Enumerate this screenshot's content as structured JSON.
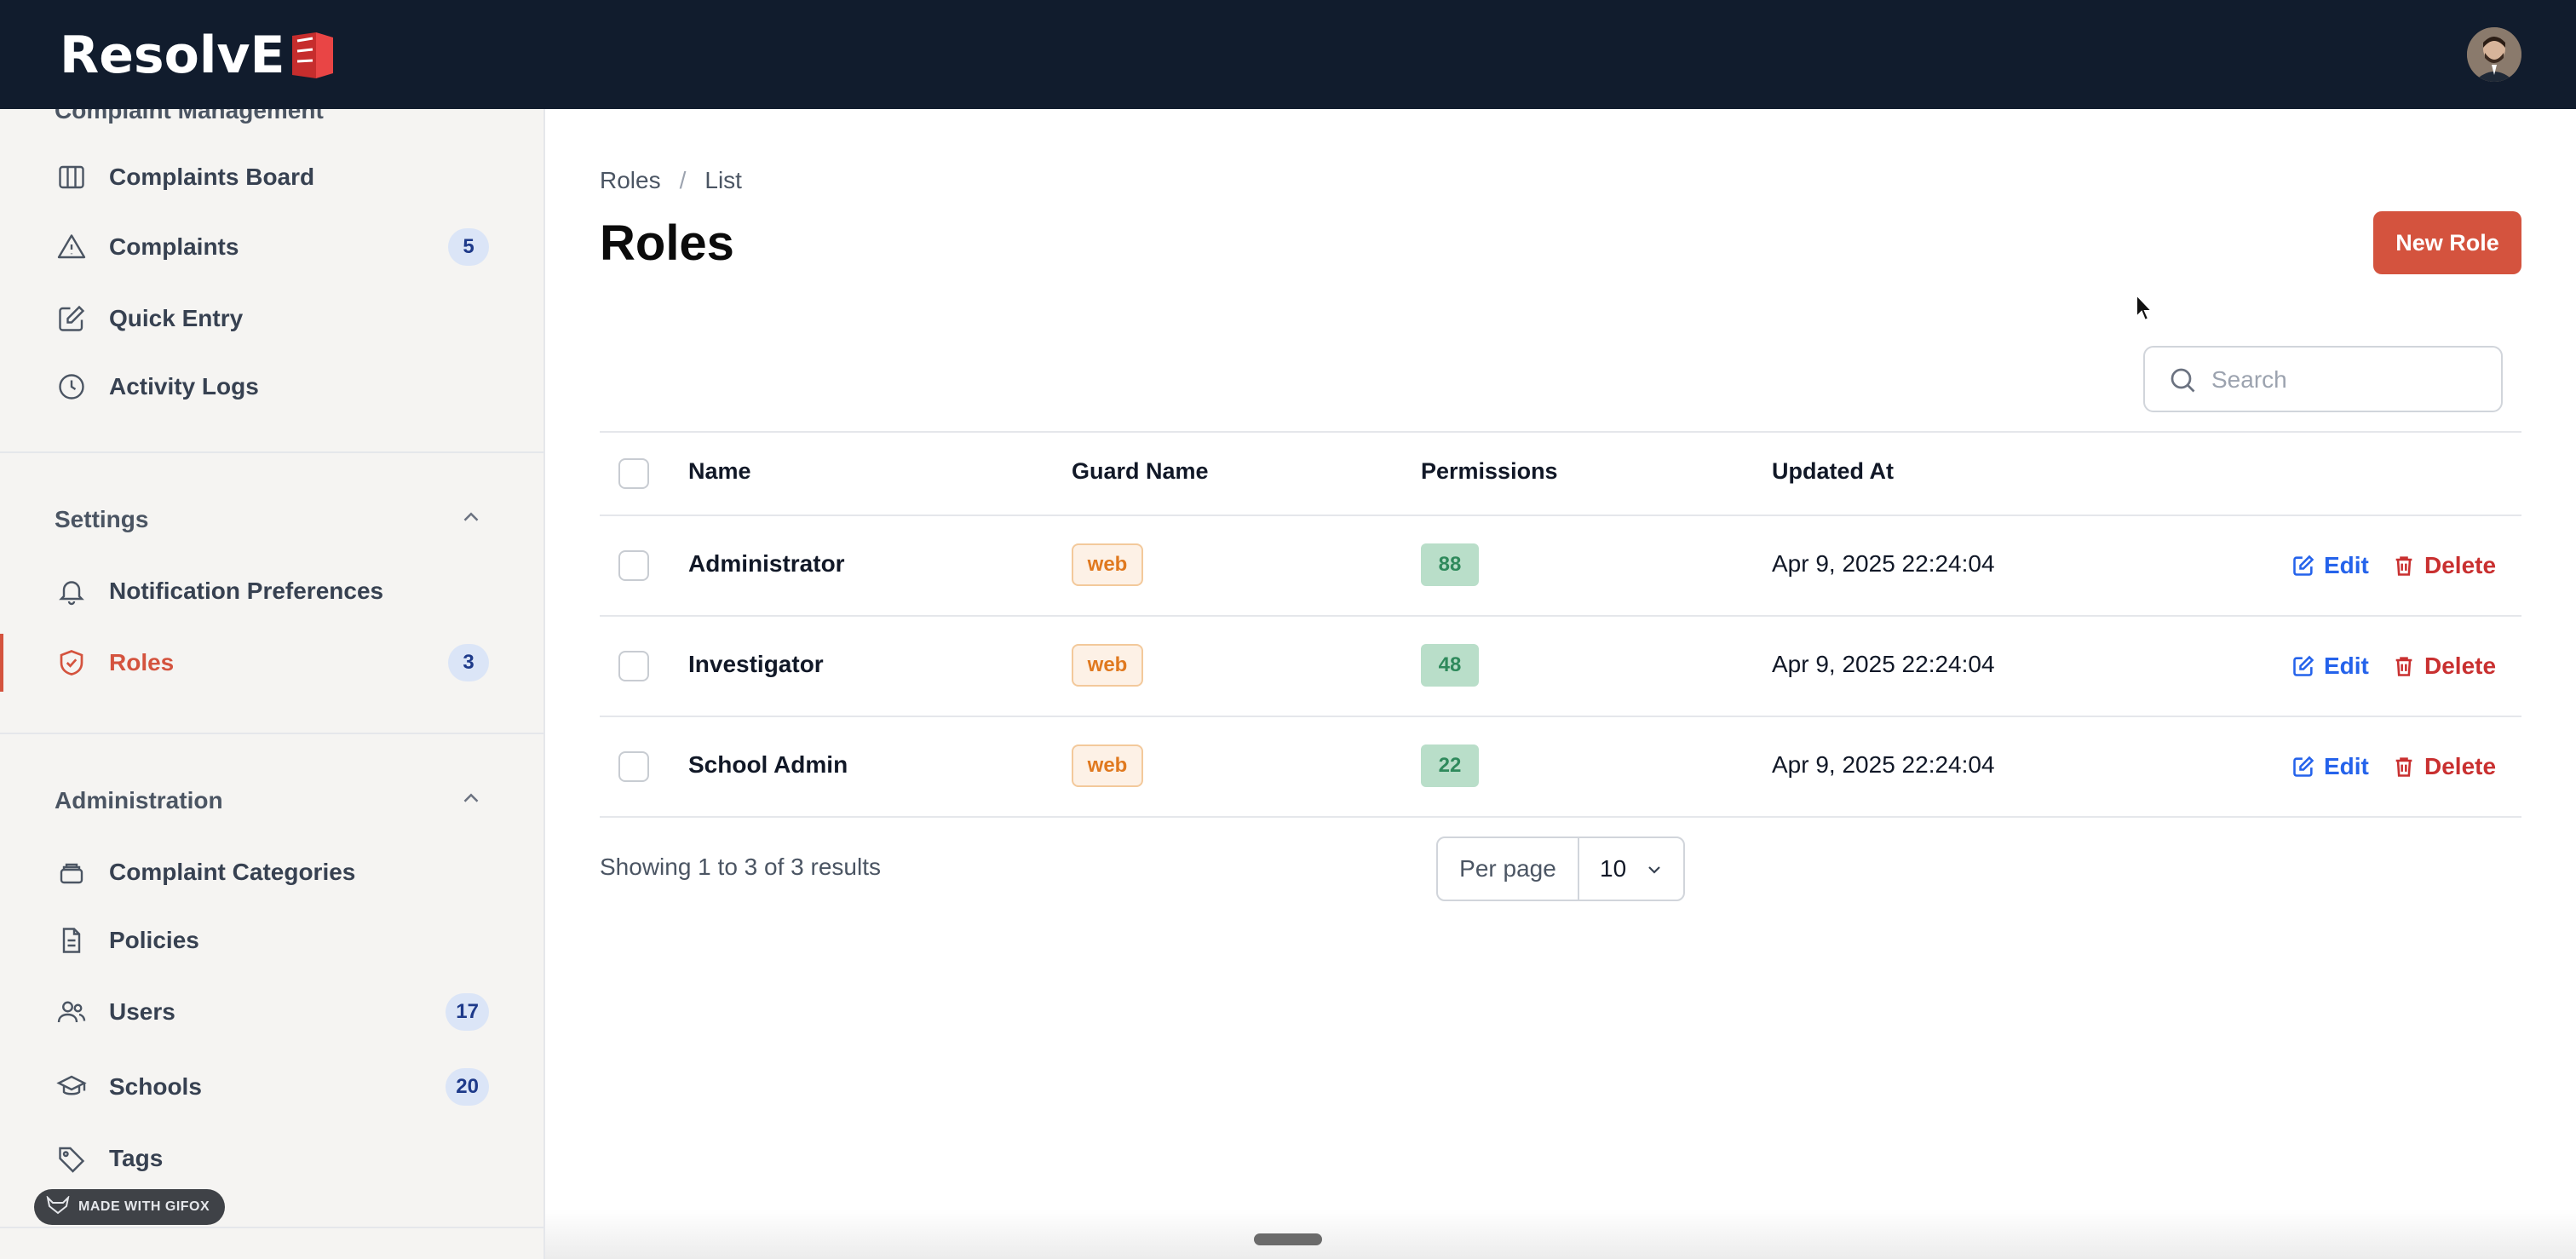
{
  "app": {
    "logo_text": "ResolvE",
    "logo_tail": "D"
  },
  "sidebar": {
    "clipped_section": "Complaint Management",
    "complaint_items": [
      {
        "label": "Complaints Board",
        "icon": "board-columns-icon"
      },
      {
        "label": "Complaints",
        "icon": "warning-triangle-icon",
        "badge": "5"
      },
      {
        "label": "Quick Entry",
        "icon": "pencil-square-icon"
      },
      {
        "label": "Activity Logs",
        "icon": "clock-icon"
      }
    ],
    "settings": {
      "title": "Settings",
      "items": [
        {
          "label": "Notification Preferences",
          "icon": "bell-icon"
        },
        {
          "label": "Roles",
          "icon": "shield-check-icon",
          "badge": "3",
          "active": true
        }
      ]
    },
    "administration": {
      "title": "Administration",
      "items": [
        {
          "label": "Complaint Categories",
          "icon": "layers-icon"
        },
        {
          "label": "Policies",
          "icon": "document-icon"
        },
        {
          "label": "Users",
          "icon": "users-icon",
          "badge": "17"
        },
        {
          "label": "Schools",
          "icon": "graduation-cap-icon",
          "badge": "20"
        },
        {
          "label": "Tags",
          "icon": "tag-icon"
        }
      ]
    }
  },
  "watermark": "MADE WITH GIFOX",
  "main": {
    "breadcrumb": [
      "Roles",
      "List"
    ],
    "title": "Roles",
    "new_button": "New Role",
    "search_placeholder": "Search",
    "table": {
      "columns": [
        "Name",
        "Guard Name",
        "Permissions",
        "Updated At"
      ],
      "rows": [
        {
          "name": "Administrator",
          "guard": "web",
          "permissions": "88",
          "updated_at": "Apr 9, 2025 22:24:04"
        },
        {
          "name": "Investigator",
          "guard": "web",
          "permissions": "48",
          "updated_at": "Apr 9, 2025 22:24:04"
        },
        {
          "name": "School Admin",
          "guard": "web",
          "permissions": "22",
          "updated_at": "Apr 9, 2025 22:24:04"
        }
      ],
      "edit_label": "Edit",
      "delete_label": "Delete"
    },
    "pagination": {
      "showing": "Showing 1 to 3 of 3 results",
      "per_page_label": "Per page",
      "per_page_value": "10"
    }
  },
  "colors": {
    "topbar": "#111c2d",
    "accent": "#d4533e",
    "edit": "#2563eb",
    "delete": "#c93030"
  }
}
